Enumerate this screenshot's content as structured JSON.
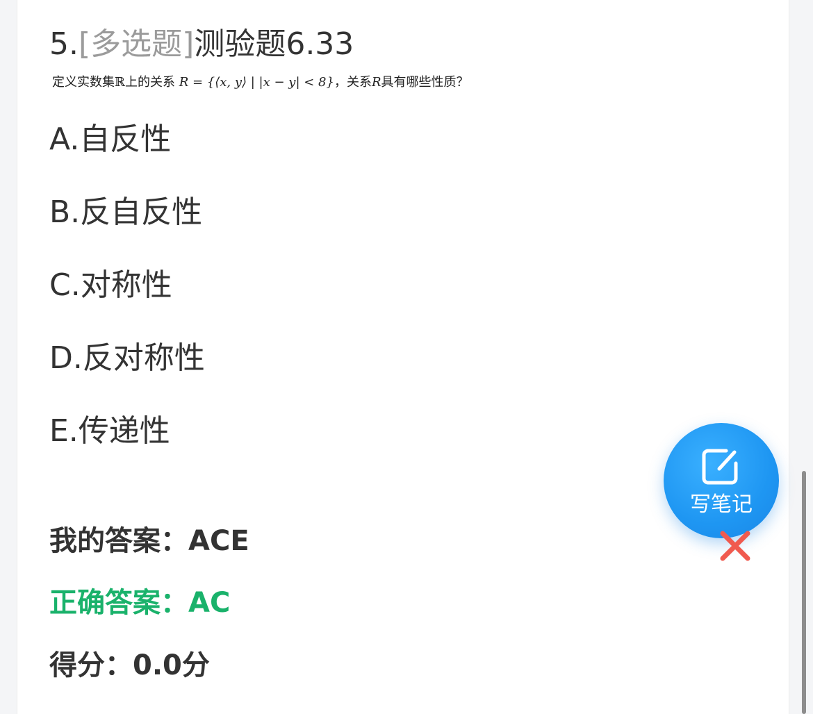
{
  "question": {
    "number": "5.",
    "type": "[多选题]",
    "title": "测验题6.33",
    "stem": {
      "part1": "定义实数集ℝ上的关系",
      "math": "R = {⟨x, y⟩ | |x − y| < 8}",
      "part2": "，关系",
      "var": "R",
      "part3": "具有哪些性质？"
    }
  },
  "options": [
    {
      "letter": "A.",
      "text": "自反性"
    },
    {
      "letter": "B.",
      "text": "反自反性"
    },
    {
      "letter": "C.",
      "text": "对称性"
    },
    {
      "letter": "D.",
      "text": "反对称性"
    },
    {
      "letter": "E.",
      "text": "传递性"
    }
  ],
  "result": {
    "my_answer_label": "我的答案：",
    "my_answer_value": "ACE",
    "correct_answer_label": "正确答案：",
    "correct_answer_value": "AC",
    "score_label": "得分：",
    "score_value": "0.0分"
  },
  "note_button": {
    "label": "写笔记",
    "icon": "edit-note-icon"
  },
  "close_icon": "close-icon",
  "colors": {
    "correct_answer": "#1ab26b",
    "fab_blue": "#1e96f2",
    "close_red": "#f05a4f",
    "type_gray": "#9b9b9b"
  }
}
